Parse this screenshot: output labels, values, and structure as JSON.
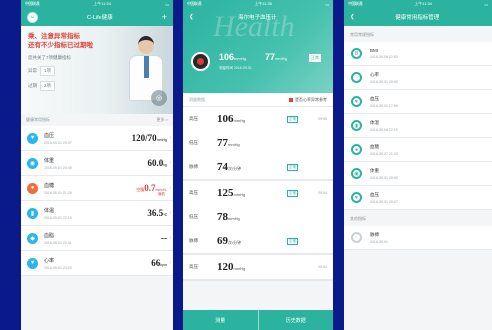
{
  "phone1": {
    "status": {
      "carrier": "中国联通",
      "time": "上午11:34"
    },
    "title": "C-Life健康",
    "banner": {
      "warn_line1": "乘、注意异常指标",
      "warn_line2": "还有不少指标已过期啦",
      "sub": "您共关了7项健康指标",
      "abnormal_label": "异常",
      "abnormal_count": "1项",
      "expired_label": "过期",
      "expired_count": "2项"
    },
    "section": {
      "title": "健康常用指标",
      "more": "更多 >"
    },
    "rows": [
      {
        "name": "血压",
        "time": "2016-09-01 20:37",
        "value": "120/70",
        "unit": "mmHg",
        "icon": "blood-pressure-icon",
        "tone": "blue"
      },
      {
        "name": "体重",
        "time": "2016-09-01 20:49",
        "value": "60.0",
        "unit": "kg",
        "icon": "weight-icon",
        "tone": "blue"
      },
      {
        "name": "血糖",
        "time": "2016-09-01 21:29",
        "value": "0.7",
        "unit": "mmol/L",
        "prefix": "空腹",
        "tag": "偏低",
        "icon": "blood-sugar-icon",
        "tone": "orange"
      },
      {
        "name": "体温",
        "time": "2016-09-01 22:19",
        "value": "36.5",
        "unit": "℃",
        "icon": "thermometer-icon",
        "tone": "blue"
      },
      {
        "name": "血脂",
        "time": "2016-09-01 22:41",
        "value": "--",
        "unit": "",
        "icon": "blood-lipid-icon",
        "tone": "blue"
      },
      {
        "name": "心率",
        "time": "2016-09-01 23:03",
        "value": "66",
        "unit": "bpm",
        "icon": "heart-rate-icon",
        "tone": "blue"
      }
    ]
  },
  "phone2": {
    "status": {
      "carrier": "中国联通",
      "time": "上午11:35"
    },
    "title": "海尔电子血压计",
    "hero": {
      "sys": "106",
      "sys_unit": "mmHg",
      "dia": "77",
      "dia_unit": "mmHg",
      "date": "测量时间 2016-09-01",
      "badge": "正常",
      "watermark": "Health"
    },
    "history_label": "测量数据",
    "legend": "是否心率异常参考",
    "groups": [
      {
        "time": "09:55",
        "rows": [
          {
            "label": "高压",
            "value": "106",
            "unit": "mmHg",
            "tag": "正常"
          },
          {
            "label": "低压",
            "value": "77",
            "unit": "mmHg",
            "tag": ""
          },
          {
            "label": "脉搏",
            "value": "74",
            "unit": "次/分钟",
            "tag": "正常"
          }
        ]
      },
      {
        "time": "09:54",
        "rows": [
          {
            "label": "高压",
            "value": "125",
            "unit": "mmHg",
            "tag": "正常"
          },
          {
            "label": "低压",
            "value": "78",
            "unit": "mmHg",
            "tag": ""
          },
          {
            "label": "脉搏",
            "value": "69",
            "unit": "次/分钟",
            "tag": "正常"
          }
        ]
      },
      {
        "time": "09:52",
        "rows": [
          {
            "label": "高压",
            "value": "120",
            "unit": "mmHg",
            "tag": ""
          }
        ]
      }
    ],
    "buttons": {
      "measure": "测量",
      "history": "历史数据"
    }
  },
  "phone3": {
    "status": {
      "carrier": "中国联通",
      "time": "上午11:34"
    },
    "title": "健康常用指标管理",
    "group1": "常用常规指标",
    "rows": [
      {
        "name": "BMI",
        "date": "2016-09-06 22:53",
        "icon": "bmi-icon"
      },
      {
        "name": "心率",
        "date": "2016-09-01 20:46",
        "icon": "heart-icon"
      },
      {
        "name": "血压",
        "date": "2016-09-01 17:59",
        "icon": "blood-pressure-icon"
      },
      {
        "name": "体温",
        "date": "2016-09-06 22:19",
        "icon": "thermometer-icon"
      },
      {
        "name": "血糖",
        "date": "2016-09-07 21:29",
        "icon": "blood-sugar-icon"
      },
      {
        "name": "体重",
        "date": "2016-09-01 20:46",
        "icon": "weight-icon"
      },
      {
        "name": "血压",
        "date": "2016-09-01 20:37",
        "icon": "blood-pressure-icon"
      }
    ],
    "group2": "其他指标",
    "other_rows": [
      {
        "name": "脉搏",
        "date": "2016-09-01",
        "icon": "pulse-icon"
      }
    ]
  },
  "colors": {
    "teal": "#2bb3a0",
    "background": "#0b1a8a",
    "alert": "#e0453d"
  }
}
